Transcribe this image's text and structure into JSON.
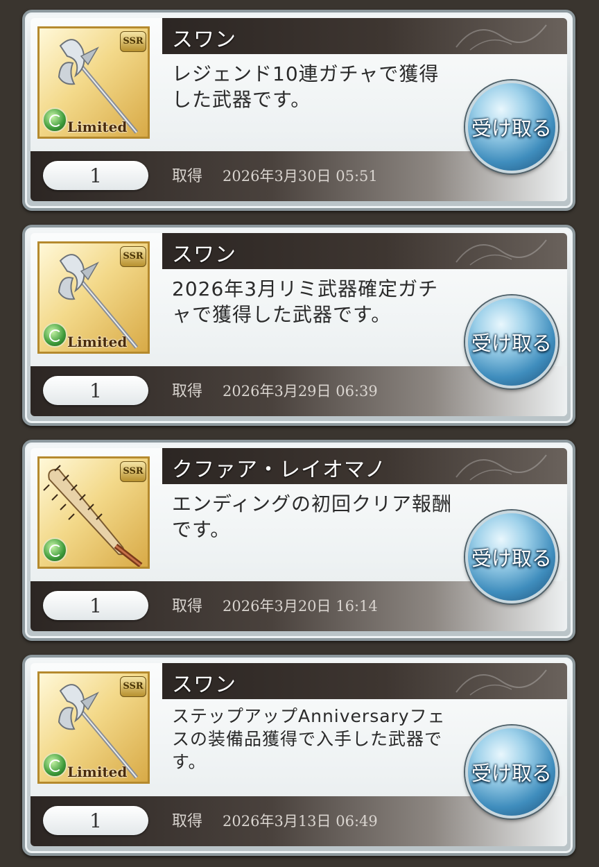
{
  "ui": {
    "count_label": "取得",
    "receive_label": "受け取る",
    "ssr_badge": "SSR",
    "limited_label": "Limited",
    "accent_blue": "#3f8dbd",
    "frame_gold": "#b58a2e"
  },
  "items": [
    {
      "name": "スワン",
      "description": "レジェンド10連ガチャで獲得した武器です。",
      "quantity": "1",
      "acquired_label": "取得",
      "acquired_date": "2026年3月30日 05:51",
      "weapon_icon": "halberd-icon",
      "limited": true
    },
    {
      "name": "スワン",
      "description": "2026年3月リミ武器確定ガチャで獲得した武器です。",
      "quantity": "1",
      "acquired_label": "取得",
      "acquired_date": "2026年3月29日 06:39",
      "weapon_icon": "halberd-icon",
      "limited": true
    },
    {
      "name": "クファア・レイオマノ",
      "description": "エンディングの初回クリア報酬です。",
      "quantity": "1",
      "acquired_label": "取得",
      "acquired_date": "2026年3月20日 16:14",
      "weapon_icon": "spiked-club-icon",
      "limited": false
    },
    {
      "name": "スワン",
      "description": "ステップアップAnniversaryフェスの装備品獲得で入手した武器です。",
      "quantity": "1",
      "acquired_label": "取得",
      "acquired_date": "2026年3月13日 06:49",
      "weapon_icon": "halberd-icon",
      "limited": true
    }
  ]
}
